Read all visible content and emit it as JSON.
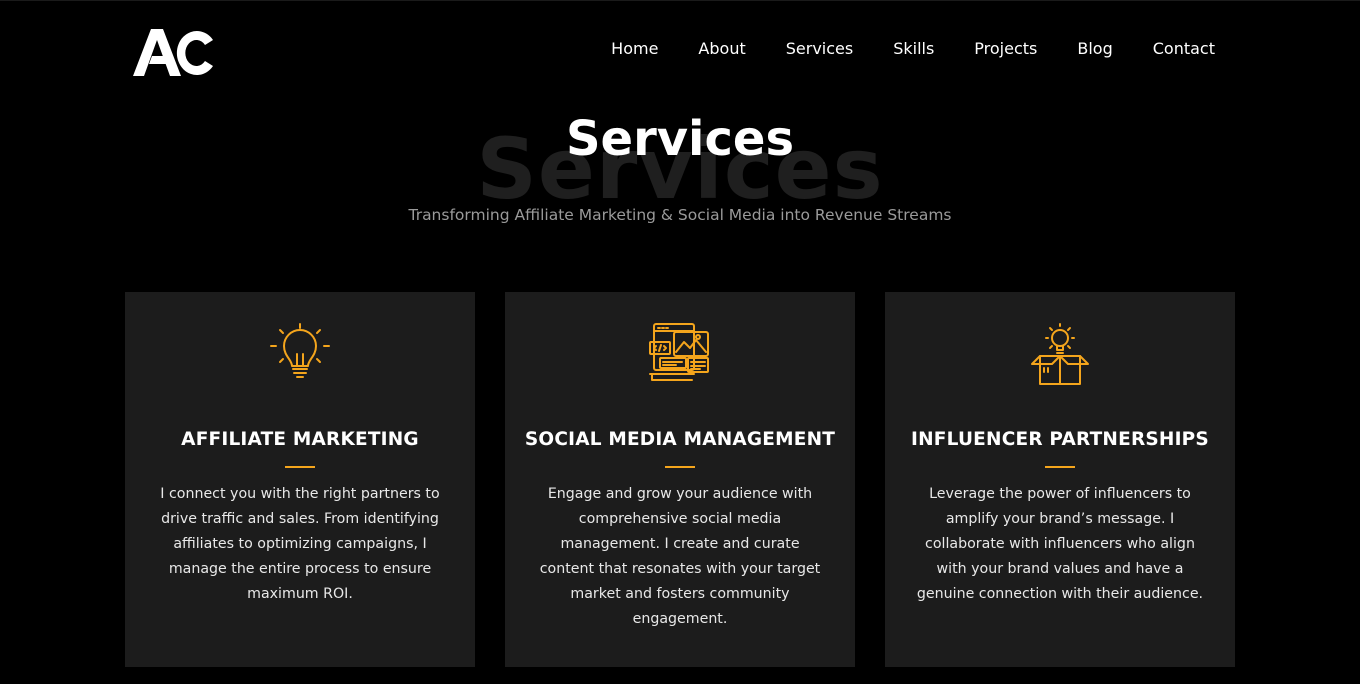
{
  "brand": {
    "logo_text": "AC",
    "accent_color": "#f4a51c"
  },
  "nav": {
    "items": [
      {
        "label": "Home"
      },
      {
        "label": "About"
      },
      {
        "label": "Services"
      },
      {
        "label": "Skills"
      },
      {
        "label": "Projects"
      },
      {
        "label": "Blog"
      },
      {
        "label": "Contact"
      }
    ]
  },
  "section": {
    "background_title": "Services",
    "title": "Services",
    "subtitle": "Transforming Affiliate Marketing & Social Media into Revenue Streams"
  },
  "cards": [
    {
      "icon": "lightbulb-icon",
      "title": "AFFILIATE MARKETING",
      "text": "I connect you with the right partners to drive traffic and sales. From identifying affiliates to optimizing campaigns, I manage the entire process to ensure maximum ROI."
    },
    {
      "icon": "web-design-icon",
      "title": "SOCIAL MEDIA MANAGEMENT",
      "text": "Engage and grow your audience with comprehensive social media management. I create and curate content that resonates with your target market and fosters community engagement."
    },
    {
      "icon": "idea-box-icon",
      "title": "INFLUENCER PARTNERSHIPS",
      "text": "Leverage the power of influencers to amplify your brand’s message. I collaborate with influencers who align with your brand values and have a genuine connection with their audience."
    }
  ]
}
